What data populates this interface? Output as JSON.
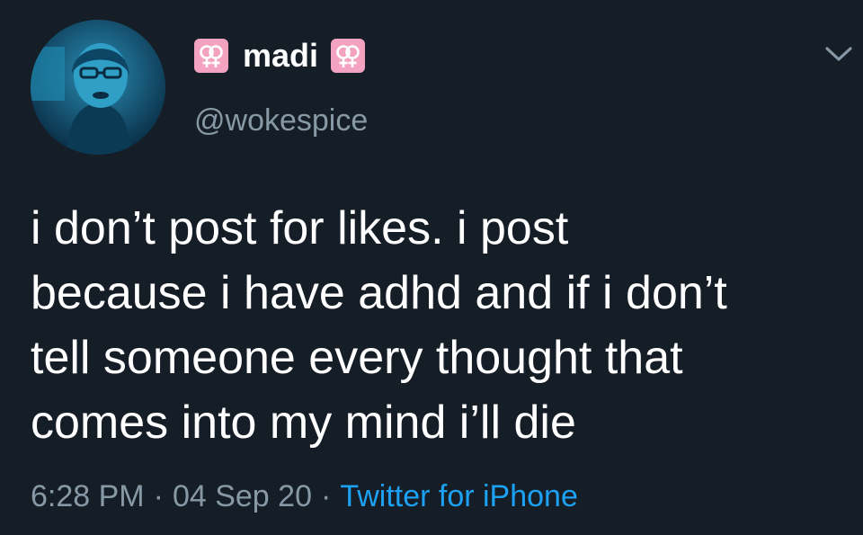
{
  "colors": {
    "background": "#151d27",
    "primary_text": "#ffffff",
    "secondary_text": "#8899a6",
    "link": "#1da1f2",
    "badge_bg": "#f3a3bf"
  },
  "author": {
    "name": "madi",
    "handle": "@wokespice",
    "badge_icon": "double-venus-icon"
  },
  "tweet": {
    "lines": [
      "i don’t post for likes. i post",
      "because i have adhd and if i don’t",
      "tell someone every thought that",
      "comes into my mind i’ll die"
    ]
  },
  "meta": {
    "time": "6:28 PM",
    "separator": "·",
    "date": "04 Sep 20",
    "source": "Twitter for iPhone"
  },
  "menu_icon": "chevron-down-icon"
}
